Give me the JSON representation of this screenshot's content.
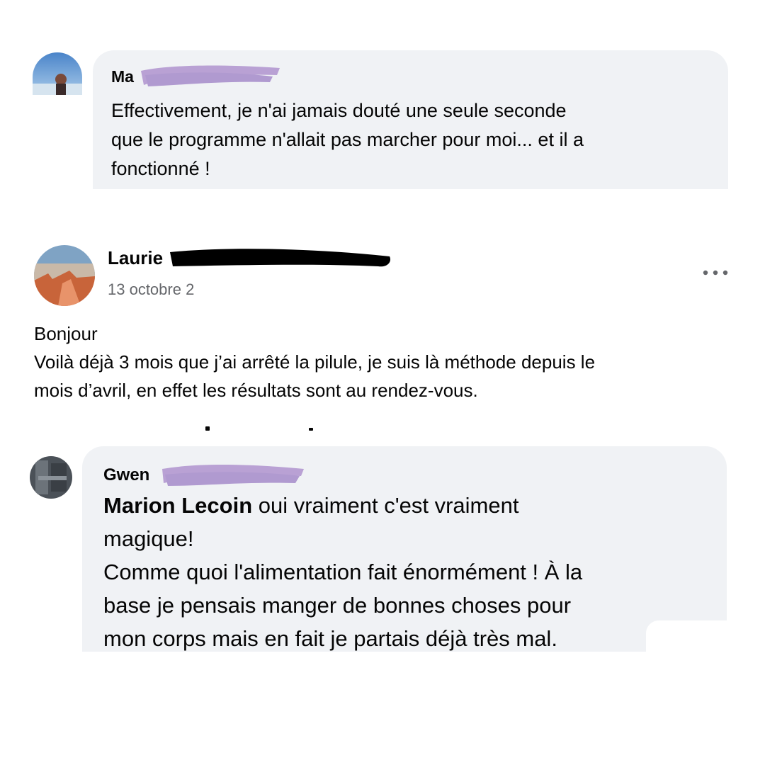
{
  "comments": [
    {
      "author_visible": "Ma",
      "text_lines": [
        "Effectivement, je n'ai jamais douté une seule seconde",
        "que le programme n'allait pas marcher pour moi... et il a",
        "fonctionné !"
      ]
    },
    {
      "author_visible": "Laurie",
      "date": "13 octobre 2",
      "more_icon": "more-horizontal-icon",
      "body_lines": [
        "Bonjour",
        "Voilà déjà 3 mois que j’ai arrêté la pilule, je suis là méthode depuis le",
        "mois d’avril, en effet les résultats sont au rendez-vous."
      ]
    },
    {
      "author_visible": "Gwen",
      "mention": "Marion Lecoin",
      "first_line_rest": " oui vraiment c'est vraiment",
      "lines": [
        "magique!",
        "Comme quoi l'alimentation fait énormément ! À la",
        "base je pensais manger de bonnes choses pour",
        "mon corps mais en fait je partais déjà très mal."
      ]
    }
  ],
  "colors": {
    "bubble": "#f0f2f5",
    "text": "#050505",
    "meta": "#65676b",
    "redaction_purple": "#b9a1d4",
    "redaction_black": "#000000"
  }
}
